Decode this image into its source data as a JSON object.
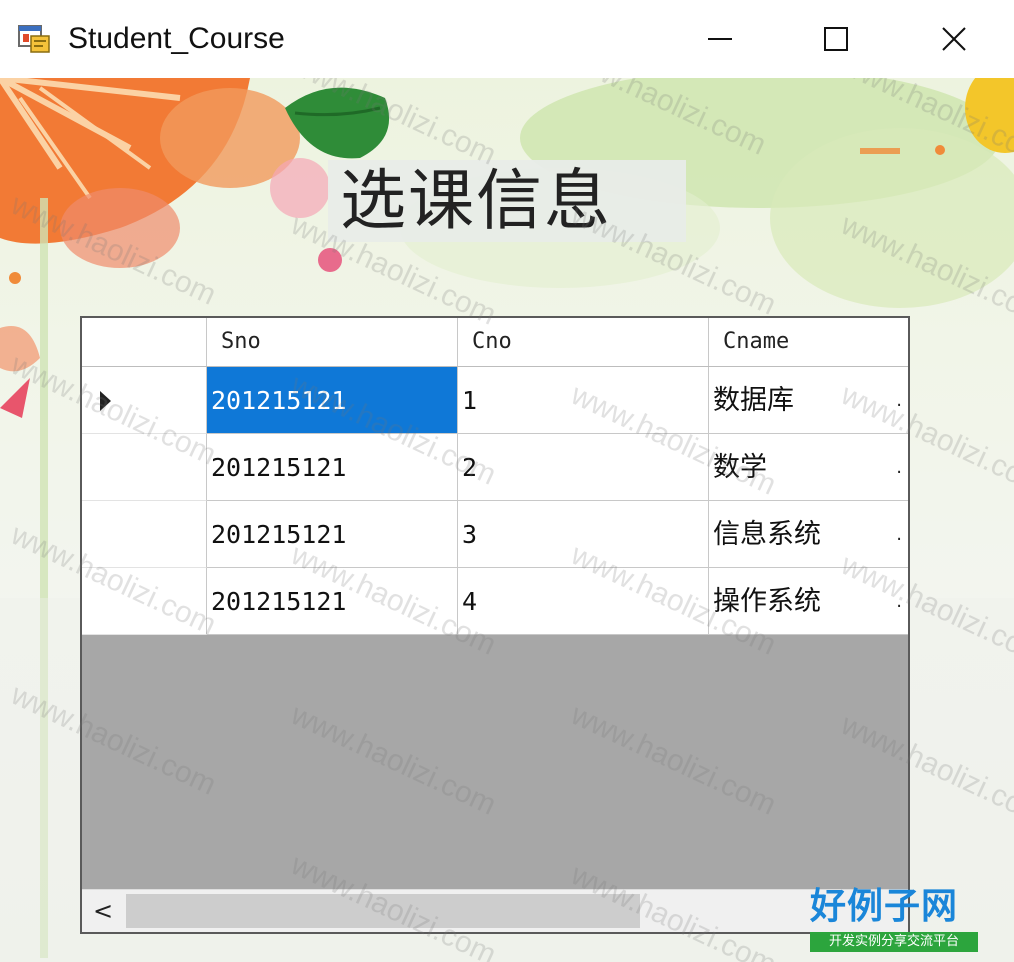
{
  "window": {
    "title": "Student_Course",
    "controls": [
      "minimize",
      "maximize",
      "close"
    ]
  },
  "heading": "选课信息",
  "grid": {
    "columns": [
      "Sno",
      "Cno",
      "Cname"
    ],
    "rows": [
      {
        "sno": "201215121",
        "cno": "1",
        "cname": "数据库",
        "trail": ".",
        "selected": true,
        "current": true
      },
      {
        "sno": "201215121",
        "cno": "2",
        "cname": "数学",
        "trail": ".",
        "selected": false,
        "current": false
      },
      {
        "sno": "201215121",
        "cno": "3",
        "cname": "信息系统",
        "trail": ".",
        "selected": false,
        "current": false
      },
      {
        "sno": "201215121",
        "cno": "4",
        "cname": "操作系统",
        "trail": ".",
        "selected": false,
        "current": false
      }
    ],
    "selection_color": "#0f78d7",
    "scroll_left_arrow": "<"
  },
  "watermark": {
    "text": "www.haolizi.com",
    "logo_title": "好例子网",
    "logo_subtitle": "开发实例分享交流平台"
  },
  "icons": [
    "app-form-icon",
    "minimize-icon",
    "maximize-icon",
    "close-icon",
    "row-pointer-icon",
    "scroll-left-icon"
  ]
}
